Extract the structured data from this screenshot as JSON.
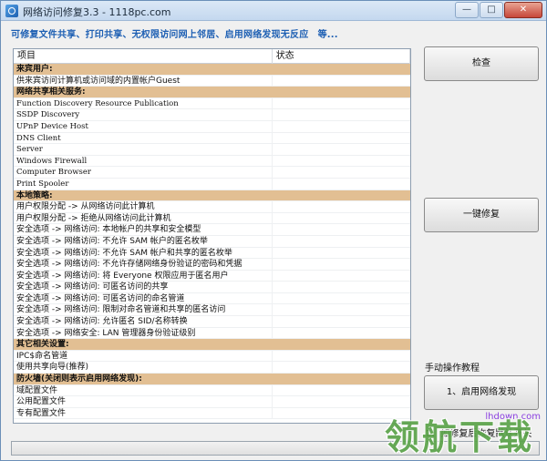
{
  "window": {
    "title": "网络访问修复3.3 - 1118pc.com",
    "minimize_glyph": "—",
    "maximize_glyph": "□",
    "close_glyph": "✕"
  },
  "subtitle": "可修复文件共享、打印共享、无权限访问网上邻居、启用网络发现无反应　等...",
  "list": {
    "columns": [
      "项目",
      "状态"
    ],
    "rows": [
      {
        "type": "cat",
        "label": "来宾用户:",
        "status": ""
      },
      {
        "type": "item",
        "label": "供来宾访问计算机或访问域的内置帐户Guest",
        "status": ""
      },
      {
        "type": "cat",
        "label": "网络共享相关服务:",
        "status": ""
      },
      {
        "type": "mono",
        "label": "Function Discovery Resource Publication",
        "status": ""
      },
      {
        "type": "mono",
        "label": "SSDP Discovery",
        "status": ""
      },
      {
        "type": "mono",
        "label": "UPnP Device Host",
        "status": ""
      },
      {
        "type": "mono",
        "label": "DNS Client",
        "status": ""
      },
      {
        "type": "mono",
        "label": "Server",
        "status": ""
      },
      {
        "type": "mono",
        "label": "Windows Firewall",
        "status": ""
      },
      {
        "type": "mono",
        "label": "Computer Browser",
        "status": ""
      },
      {
        "type": "mono",
        "label": "Print Spooler",
        "status": ""
      },
      {
        "type": "cat",
        "label": "本地策略:",
        "status": ""
      },
      {
        "type": "item",
        "label": "用户权限分配 -> 从网络访问此计算机",
        "status": ""
      },
      {
        "type": "item",
        "label": "用户权限分配 -> 拒绝从网络访问此计算机",
        "status": ""
      },
      {
        "type": "item",
        "label": "安全选项 -> 网络访问: 本地帐户的共享和安全模型",
        "status": ""
      },
      {
        "type": "item",
        "label": "安全选项 -> 网络访问: 不允许 SAM 帐户的匿名枚举",
        "status": ""
      },
      {
        "type": "item",
        "label": "安全选项 -> 网络访问: 不允许 SAM 帐户和共享的匿名枚举",
        "status": ""
      },
      {
        "type": "item",
        "label": "安全选项 -> 网络访问: 不允许存储网络身份验证的密码和凭据",
        "status": ""
      },
      {
        "type": "item",
        "label": "安全选项 -> 网络访问: 将 Everyone 权限应用于匿名用户",
        "status": ""
      },
      {
        "type": "item",
        "label": "安全选项 -> 网络访问: 可匿名访问的共享",
        "status": ""
      },
      {
        "type": "item",
        "label": "安全选项 -> 网络访问: 可匿名访问的命名管道",
        "status": ""
      },
      {
        "type": "item",
        "label": "安全选项 -> 网络访问: 限制对命名管道和共享的匿名访问",
        "status": ""
      },
      {
        "type": "item",
        "label": "安全选项 -> 网络访问: 允许匿名 SID/名称转换",
        "status": ""
      },
      {
        "type": "item",
        "label": "安全选项 -> 网络安全: LAN 管理器身份验证级别",
        "status": ""
      },
      {
        "type": "cat",
        "label": "其它相关设置:",
        "status": ""
      },
      {
        "type": "item",
        "label": "IPC$命名管道",
        "status": ""
      },
      {
        "type": "item",
        "label": "使用共享向导(推荐)",
        "status": ""
      },
      {
        "type": "cat",
        "label": "防火墙(关闭则表示启用网络发现):",
        "status": ""
      },
      {
        "type": "item",
        "label": "域配置文件",
        "status": ""
      },
      {
        "type": "item",
        "label": "公用配置文件",
        "status": ""
      },
      {
        "type": "item",
        "label": "专有配置文件",
        "status": ""
      }
    ]
  },
  "buttons": {
    "check": "检查",
    "repair": "一键修复",
    "enable_discovery": "1、启用网络发现"
  },
  "labels": {
    "manual": "手动操作教程",
    "restore": "2、如修复后恢复默认开关"
  },
  "progress": {
    "value": 0
  },
  "watermark": {
    "site": "lhdown.com",
    "brand": "领航下载"
  },
  "colors": {
    "category_row": "#e2bf93",
    "subtitle": "#1d5fb3",
    "title_bar": "#c4d8ef",
    "close_button": "#c7473a"
  },
  "icons": [
    "app-network-icon",
    "minimize-icon",
    "maximize-icon",
    "close-icon"
  ]
}
